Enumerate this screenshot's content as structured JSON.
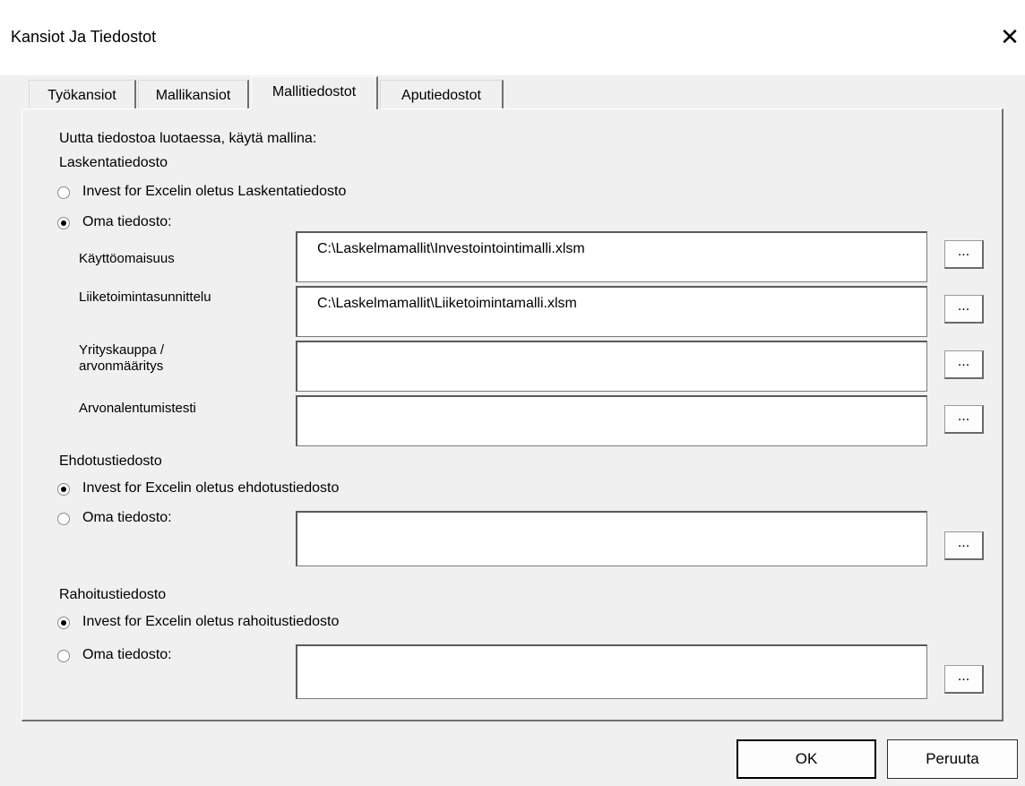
{
  "window": {
    "title": "Kansiot Ja Tiedostot",
    "close_glyph": "✕"
  },
  "tabs": [
    {
      "label": "Työkansiot"
    },
    {
      "label": "Mallikansiot"
    },
    {
      "label": "Mallitiedostot"
    },
    {
      "label": "Aputiedostot"
    }
  ],
  "active_tab": "Mallitiedostot",
  "intro": "Uutta tiedostoa luotaessa, käytä mallina:",
  "laskenta": {
    "heading": "Laskentatiedosto",
    "option_default": "Invest for Excelin oletus Laskentatiedosto",
    "option_own": "Oma tiedosto:",
    "selected": "own",
    "rows": [
      {
        "label": "Käyttöomaisuus",
        "value": "C:\\Laskelmamallit\\Investointointimalli.xlsm"
      },
      {
        "label": "Liiketoimintasunnittelu",
        "value": "C:\\Laskelmamallit\\Liiketoimintamalli.xlsm"
      },
      {
        "label_line1": "Yrityskauppa /",
        "label_line2": "arvonmääritys",
        "value": ""
      },
      {
        "label": "Arvonalentumistesti",
        "value": ""
      }
    ]
  },
  "ehdotus": {
    "heading": "Ehdotustiedosto",
    "option_default": "Invest for Excelin oletus ehdotustiedosto",
    "option_own": "Oma tiedosto:",
    "selected": "default",
    "value": ""
  },
  "rahoitus": {
    "heading": "Rahoitustiedosto",
    "option_default": "Invest for Excelin oletus rahoitustiedosto",
    "option_own": "Oma tiedosto:",
    "selected": "default",
    "value": ""
  },
  "browse_label": "...",
  "buttons": {
    "ok": "OK",
    "cancel": "Peruuta"
  }
}
